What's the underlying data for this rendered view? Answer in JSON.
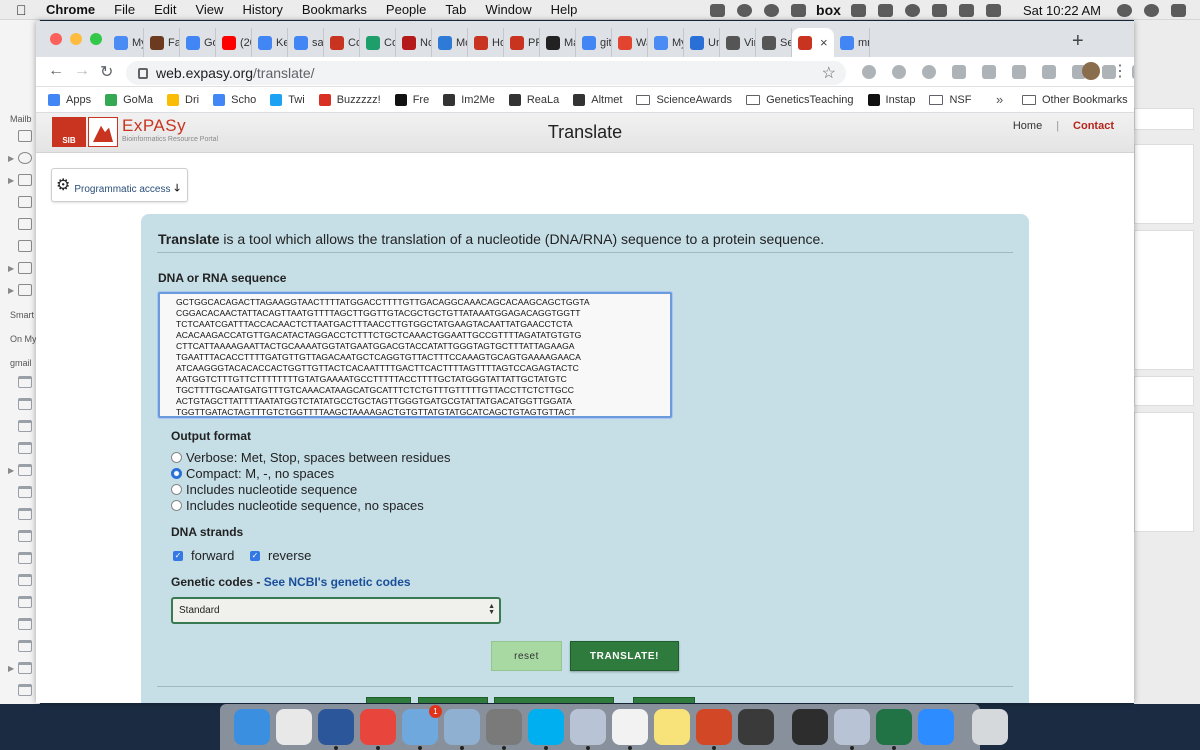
{
  "menubar": {
    "app": "Chrome",
    "items": [
      "File",
      "Edit",
      "View",
      "History",
      "Bookmarks",
      "People",
      "Tab",
      "Window",
      "Help"
    ],
    "status_text": "box",
    "clock": "Sat 10:22 AM"
  },
  "mail_sidebar": {
    "labels": [
      "Mailb",
      "Smart",
      "On My",
      "gmail"
    ]
  },
  "browser": {
    "tabs": [
      {
        "label": "My",
        "color": "#4b8bf4"
      },
      {
        "label": "Fac",
        "color": "#6b3a1f"
      },
      {
        "label": "Go",
        "color": "#4285f4"
      },
      {
        "label": "(20",
        "color": "#ff0000"
      },
      {
        "label": "Ke",
        "color": "#4285f4"
      },
      {
        "label": "sar",
        "color": "#4285f4"
      },
      {
        "label": "Co",
        "color": "#c8341f"
      },
      {
        "label": "Co",
        "color": "#1e9e6a"
      },
      {
        "label": "No",
        "color": "#b51a1a"
      },
      {
        "label": "Mc",
        "color": "#2d7bd6"
      },
      {
        "label": "Ho",
        "color": "#c8341f"
      },
      {
        "label": "PR",
        "color": "#c8341f"
      },
      {
        "label": "Ma",
        "color": "#222222"
      },
      {
        "label": "git",
        "color": "#4285f4"
      },
      {
        "label": "Wa",
        "color": "#e2442f"
      },
      {
        "label": "My",
        "color": "#4b8bf4"
      },
      {
        "label": "Un",
        "color": "#2a6fd6"
      },
      {
        "label": "Vir",
        "color": "#555555"
      },
      {
        "label": "Se",
        "color": "#555555"
      }
    ],
    "tabs_after_active": [
      {
        "label": "mr",
        "color": "#4285f4"
      }
    ],
    "active_tab": {
      "close": "×",
      "color": "#c8341f"
    },
    "url_domain": "web.expasy.org",
    "url_path": "/translate/",
    "bookmarks": [
      {
        "label": "Apps",
        "color": "#4285f4"
      },
      {
        "label": "GoMa",
        "color": "#34a853"
      },
      {
        "label": "Dri",
        "color": "#fbbc05"
      },
      {
        "label": "Scho",
        "color": "#4285f4"
      },
      {
        "label": "Twi",
        "color": "#1da1f2"
      },
      {
        "label": "Buzzzzz!",
        "color": "#d93025"
      },
      {
        "label": "Fre",
        "color": "#111111"
      },
      {
        "label": "Im2Me",
        "color": "#333333"
      },
      {
        "label": "ReaLa",
        "color": "#333333"
      },
      {
        "label": "Altmet",
        "color": "#333333"
      },
      {
        "label": "ScienceAwards",
        "color": "folder"
      },
      {
        "label": "GeneticsTeaching",
        "color": "folder"
      },
      {
        "label": "Instap",
        "color": "#111111"
      },
      {
        "label": "NSF",
        "color": "folder"
      }
    ],
    "bookmarks_more": "»",
    "other_bookmarks": "Other Bookmarks"
  },
  "page": {
    "sib_label": "SIB",
    "logo_name": "ExPASy",
    "logo_sub": "Bioinformatics Resource Portal",
    "title": "Translate",
    "nav_home": "Home",
    "nav_sep": "|",
    "nav_contact": "Contact",
    "programmatic_access": "Programmatic access",
    "intro_bold": "Translate",
    "intro_rest": " is a tool which allows the translation of a nucleotide (DNA/RNA) sequence to a protein sequence.",
    "seq_label": "DNA or RNA sequence",
    "sequence_lines": [
      "GCTGGCACAGACTTAGAAGGTAACTTTTATGGACCTTTTGTTGACAGGCAAACAGCACAAGCAGCTGGTA",
      "CGGACACAACTATTACAGTTAATGTTTTAGCTTGGTTGTACGCTGCTGTTATAAATGGAGACAGGTGGTT",
      "TCTCAATCGATTTACCACAACTCTTAATGACTTTAACCTTGTGGCTATGAAGTACAATTATGAACCTCTA",
      "ACACAAGACCATGTTGACATACTAGGACCTCTTTCTGCTCAAACTGGAATTGCCGTTTTAGATATGTGTG",
      "CTTCATTAAAAGAATTACTGCAAAATGGTATGAATGGACGTACCATATTGGGTAGTGCTTTATTAGAAGA",
      "TGAATTTACACCTTTTGATGTTGTTAGACAATGCTCAGGTGTTACTTTCCAAAGTGCAGTGAAAAGAACA",
      "ATCAAGGGTACACACCACTGGTTGTTACTCACAATTTTGACTTCACTTTTAGTTTTAGTCCAGAGTACTC",
      "AATGGTCTTTGTTCTTTTTTTTGTATGAAAATGCCTTTTTACCTTTTGCTATGGGTATTATTGCTATGTC",
      "TGCTTTTGCAATGATGTTTGTCAAACATAAGCATGCATTTCTCTGTTTGTTTTTGTTACCTTCTCTTGCC",
      "ACTGTAGCTTATTTTAATATGGTCTATATGCCTGCTAGTTGGGTGATGCGTATTATGACATGGTTGGATA",
      "TGGTTGATACTAGTTTGTCTGGTTTTAAGCTAAAAGACTGTGTTATGTATGCATCAGCTGTAGTGTTACT"
    ],
    "output_format_label": "Output format",
    "output_options": [
      {
        "label": "Verbose: Met, Stop, spaces between residues",
        "selected": false
      },
      {
        "label": "Compact: M, -, no spaces",
        "selected": true
      },
      {
        "label": "Includes nucleotide sequence",
        "selected": false
      },
      {
        "label": "Includes nucleotide sequence, no spaces",
        "selected": false
      }
    ],
    "strands_label": "DNA strands",
    "strand_forward": "forward",
    "strand_reverse": "reverse",
    "genetic_codes_label": "Genetic codes - ",
    "genetic_codes_link": "See NCBI's genetic codes",
    "genetic_code_selected": "Standard",
    "reset_label": "reset",
    "translate_label": "TRANSLATE!"
  },
  "dock": {
    "badge_count": "1",
    "apps": [
      {
        "name": "finder",
        "color": "#3a8fe0"
      },
      {
        "name": "textedit",
        "color": "#e8e8e8"
      },
      {
        "name": "word",
        "color": "#2b579a"
      },
      {
        "name": "chrome",
        "color": "#e8453c"
      },
      {
        "name": "mail",
        "color": "#6fa8dc"
      },
      {
        "name": "preview",
        "color": "#8fb0d0"
      },
      {
        "name": "system-preferences",
        "color": "#7a7a7a"
      },
      {
        "name": "skype",
        "color": "#00aff0"
      },
      {
        "name": "r",
        "color": "#b8c4d6"
      },
      {
        "name": "slack",
        "color": "#f2f2f2"
      },
      {
        "name": "notes",
        "color": "#f7e37a"
      },
      {
        "name": "powerpoint",
        "color": "#d24726"
      },
      {
        "name": "circle-app",
        "color": "#3a3a3a"
      },
      {
        "name": "quicktime",
        "color": "#2d2d2d"
      },
      {
        "name": "r-project",
        "color": "#b8c4d6"
      },
      {
        "name": "excel",
        "color": "#217346"
      },
      {
        "name": "zoom",
        "color": "#2d8cff"
      },
      {
        "name": "trash",
        "color": "#d6d9dc"
      }
    ]
  }
}
